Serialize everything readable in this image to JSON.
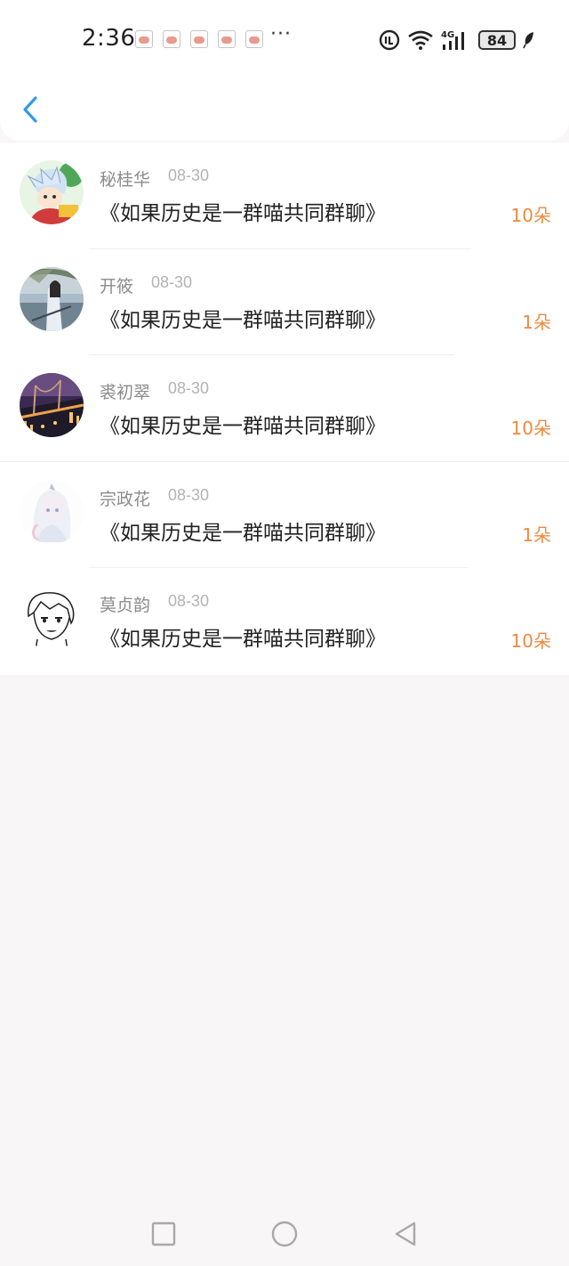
{
  "status_bar": {
    "time": "2:36",
    "more": "···",
    "battery": "84",
    "notification_icons": [
      "pig-notification-icon",
      "pig-notification-icon",
      "pig-notification-icon",
      "pig-notification-icon",
      "pig-notification-icon"
    ],
    "system_icons": [
      "hd-call-icon",
      "wifi-icon",
      "signal-4g-icon",
      "battery-icon",
      "leaf-icon"
    ]
  },
  "header": {
    "back_icon": "chevron-left-icon",
    "accent_color": "#2f9bea"
  },
  "gifts": [
    {
      "name": "秘桂华",
      "date": "08-30",
      "title": "《如果历史是一群喵共同群聊》",
      "count": "10朵"
    },
    {
      "name": "开筱",
      "date": "08-30",
      "title": "《如果历史是一群喵共同群聊》",
      "count": "1朵"
    },
    {
      "name": "裘初翠",
      "date": "08-30",
      "title": "《如果历史是一群喵共同群聊》",
      "count": "10朵"
    },
    {
      "name": "宗政花",
      "date": "08-30",
      "title": "《如果历史是一群喵共同群聊》",
      "count": "1朵"
    },
    {
      "name": "莫贞韵",
      "date": "08-30",
      "title": "《如果历史是一群喵共同群聊》",
      "count": "10朵"
    }
  ],
  "count_color": "#ef8a3f",
  "nav": {
    "recents_icon": "square-icon",
    "home_icon": "circle-icon",
    "back_icon": "triangle-back-icon"
  }
}
